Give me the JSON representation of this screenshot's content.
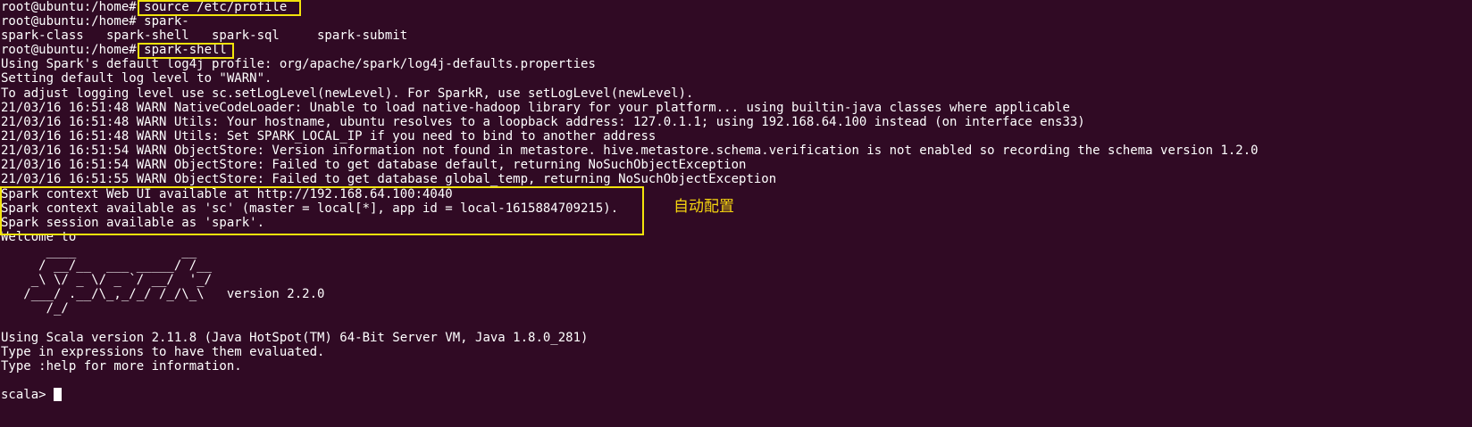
{
  "terminal": {
    "lines": [
      "root@ubuntu:/home# source /etc/profile",
      "root@ubuntu:/home# spark-",
      "spark-class   spark-shell   spark-sql     spark-submit",
      "root@ubuntu:/home# spark-shell",
      "Using Spark's default log4j profile: org/apache/spark/log4j-defaults.properties",
      "Setting default log level to \"WARN\".",
      "To adjust logging level use sc.setLogLevel(newLevel). For SparkR, use setLogLevel(newLevel).",
      "21/03/16 16:51:48 WARN NativeCodeLoader: Unable to load native-hadoop library for your platform... using builtin-java classes where applicable",
      "21/03/16 16:51:48 WARN Utils: Your hostname, ubuntu resolves to a loopback address: 127.0.1.1; using 192.168.64.100 instead (on interface ens33)",
      "21/03/16 16:51:48 WARN Utils: Set SPARK_LOCAL_IP if you need to bind to another address",
      "21/03/16 16:51:54 WARN ObjectStore: Version information not found in metastore. hive.metastore.schema.verification is not enabled so recording the schema version 1.2.0",
      "21/03/16 16:51:54 WARN ObjectStore: Failed to get database default, returning NoSuchObjectException",
      "21/03/16 16:51:55 WARN ObjectStore: Failed to get database global_temp, returning NoSuchObjectException",
      "Spark context Web UI available at http://192.168.64.100:4040",
      "Spark context available as 'sc' (master = local[*], app id = local-1615884709215).",
      "Spark session available as 'spark'.",
      "Welcome to",
      "      ____              __",
      "     / __/__  ___ _____/ /__",
      "    _\\ \\/ _ \\/ _ `/ __/  '_/",
      "   /___/ .__/\\_,_/_/ /_/\\_\\   version 2.2.0",
      "      /_/",
      "",
      "Using Scala version 2.11.8 (Java HotSpot(TM) 64-Bit Server VM, Java 1.8.0_281)",
      "Type in expressions to have them evaluated.",
      "Type :help for more information.",
      "",
      "scala> "
    ],
    "annotation": "自动配置"
  },
  "colors": {
    "background": "#300a24",
    "text": "#ffffff",
    "highlight_box": "#f2e30b",
    "annotation": "#f5d40f"
  }
}
